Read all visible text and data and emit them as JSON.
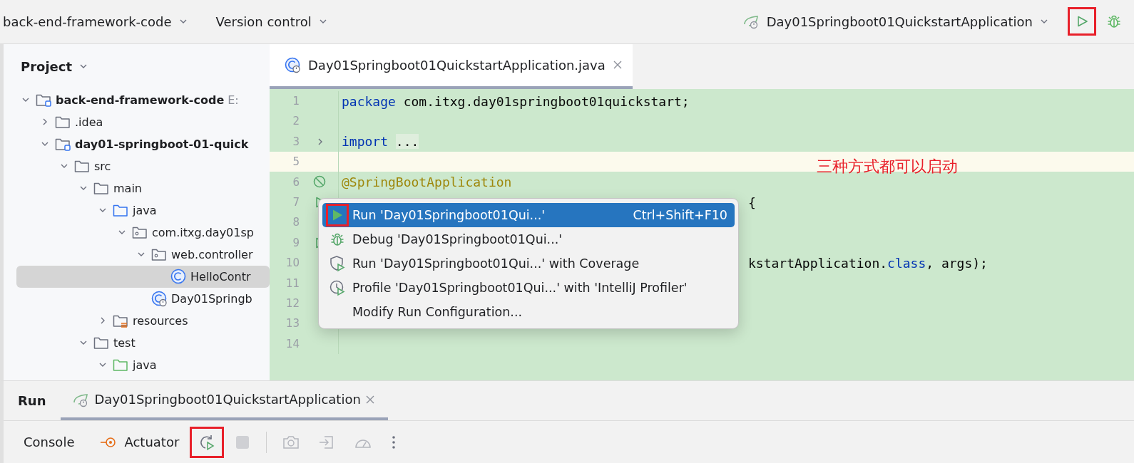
{
  "toolbar": {
    "project": "back-end-framework-code",
    "vcs": "Version control",
    "run_config": "Day01Springboot01QuickstartApplication",
    "run_button": {
      "highlighted": true
    }
  },
  "project_panel": {
    "title": "Project",
    "tree": [
      {
        "label": "back-end-framework-code",
        "hint": "E:",
        "kind": "module",
        "bold": true,
        "expanded": true,
        "selected": false,
        "children": [
          {
            "label": ".idea",
            "kind": "folder",
            "bold": false,
            "expanded": false,
            "selected": false
          },
          {
            "label": "day01-springboot-01-quick",
            "kind": "module",
            "bold": true,
            "expanded": true,
            "selected": false,
            "children": [
              {
                "label": "src",
                "kind": "folder",
                "bold": false,
                "expanded": true,
                "selected": false,
                "children": [
                  {
                    "label": "main",
                    "kind": "folder",
                    "bold": false,
                    "expanded": true,
                    "selected": false,
                    "children": [
                      {
                        "label": "java",
                        "kind": "source-folder",
                        "bold": false,
                        "expanded": true,
                        "selected": false,
                        "children": [
                          {
                            "label": "com.itxg.day01sp",
                            "kind": "package",
                            "bold": false,
                            "expanded": true,
                            "selected": false,
                            "children": [
                              {
                                "label": "web.controller",
                                "kind": "package",
                                "bold": false,
                                "expanded": true,
                                "selected": false,
                                "children": [
                                  {
                                    "label": "HelloContr",
                                    "kind": "class",
                                    "bold": false,
                                    "selected": true
                                  }
                                ]
                              },
                              {
                                "label": "Day01Springb",
                                "kind": "spring-class",
                                "bold": false,
                                "selected": false
                              }
                            ]
                          }
                        ]
                      },
                      {
                        "label": "resources",
                        "kind": "resources",
                        "bold": false,
                        "expanded": false,
                        "selected": false
                      }
                    ]
                  },
                  {
                    "label": "test",
                    "kind": "folder",
                    "bold": false,
                    "expanded": true,
                    "selected": false,
                    "children": [
                      {
                        "label": "java",
                        "kind": "test-folder",
                        "bold": false,
                        "expanded": true,
                        "selected": false
                      }
                    ]
                  }
                ]
              }
            ]
          }
        ]
      }
    ]
  },
  "editor": {
    "tab": {
      "label": "Day01Springboot01QuickstartApplication.java",
      "selected": true
    },
    "lines": [
      {
        "number": "1",
        "kind": "plain",
        "current": false,
        "segments": [
          {
            "kind": "keyword",
            "text": "package"
          },
          {
            "kind": "plain",
            "text": " com.itxg.day01springboot01quickstart;"
          }
        ]
      },
      {
        "number": "2",
        "kind": "plain",
        "current": false
      },
      {
        "number": "3",
        "kind": "fold",
        "current": false,
        "segments": [
          {
            "kind": "keyword",
            "text": "import"
          },
          {
            "kind": "folded",
            "text": "..."
          }
        ]
      },
      {
        "number": "5",
        "kind": "plain",
        "current": true
      },
      {
        "number": "6",
        "kind": "disabled",
        "current": false,
        "segments": [
          {
            "kind": "annotation",
            "text": "@SpringBootApplication"
          }
        ]
      },
      {
        "number": "7",
        "kind": "run",
        "current": false,
        "start_hidden": true,
        "segments": [
          {
            "kind": "plain",
            "text": "{"
          }
        ]
      },
      {
        "number": "8",
        "kind": "plain",
        "current": false
      },
      {
        "number": "9",
        "kind": "run",
        "current": false
      },
      {
        "number": "10",
        "kind": "plain",
        "current": false,
        "start_hidden": true,
        "segments": [
          {
            "kind": "plain",
            "text": "kstartApplication."
          },
          {
            "kind": "keyword",
            "text": "class"
          },
          {
            "kind": "plain",
            "text": ", args);"
          }
        ]
      },
      {
        "number": "11",
        "kind": "plain",
        "current": false
      },
      {
        "number": "12",
        "kind": "plain",
        "current": false
      },
      {
        "number": "13",
        "kind": "plain",
        "current": false
      },
      {
        "number": "14",
        "kind": "plain",
        "current": false
      }
    ],
    "note": "三种方式都可以启动",
    "popup": [
      {
        "kind": "run",
        "label": "Run 'Day01Springboot01Qui...'",
        "shortcut": "Ctrl+Shift+F10",
        "selected": true,
        "highlighted": true
      },
      {
        "kind": "debug",
        "label": "Debug 'Day01Springboot01Qui...'",
        "selected": false,
        "highlighted": false
      },
      {
        "kind": "coverage",
        "label": "Run 'Day01Springboot01Qui...' with Coverage",
        "selected": false,
        "highlighted": false
      },
      {
        "kind": "profiler",
        "label": "Profile 'Day01Springboot01Qui...' with 'IntelliJ Profiler'",
        "selected": false,
        "highlighted": false
      },
      {
        "kind": "plain",
        "label": "Modify Run Configuration...",
        "selected": false,
        "highlighted": false
      }
    ]
  },
  "run_panel": {
    "title": "Run",
    "tab": {
      "label": "Day01Springboot01QuickstartApplication",
      "selected": true
    },
    "tools": [
      {
        "kind": "tab",
        "label": "Console"
      },
      {
        "kind": "actuator",
        "label": "Actuator"
      },
      {
        "kind": "rerun",
        "highlighted": true,
        "disabled": false
      },
      {
        "kind": "stop",
        "highlighted": false,
        "disabled": true
      },
      {
        "kind": "separator"
      },
      {
        "kind": "camera",
        "highlighted": false,
        "disabled": true
      },
      {
        "kind": "import",
        "highlighted": false,
        "disabled": true
      },
      {
        "kind": "gauge",
        "highlighted": false,
        "disabled": true
      },
      {
        "kind": "more",
        "highlighted": false,
        "disabled": false
      }
    ]
  }
}
